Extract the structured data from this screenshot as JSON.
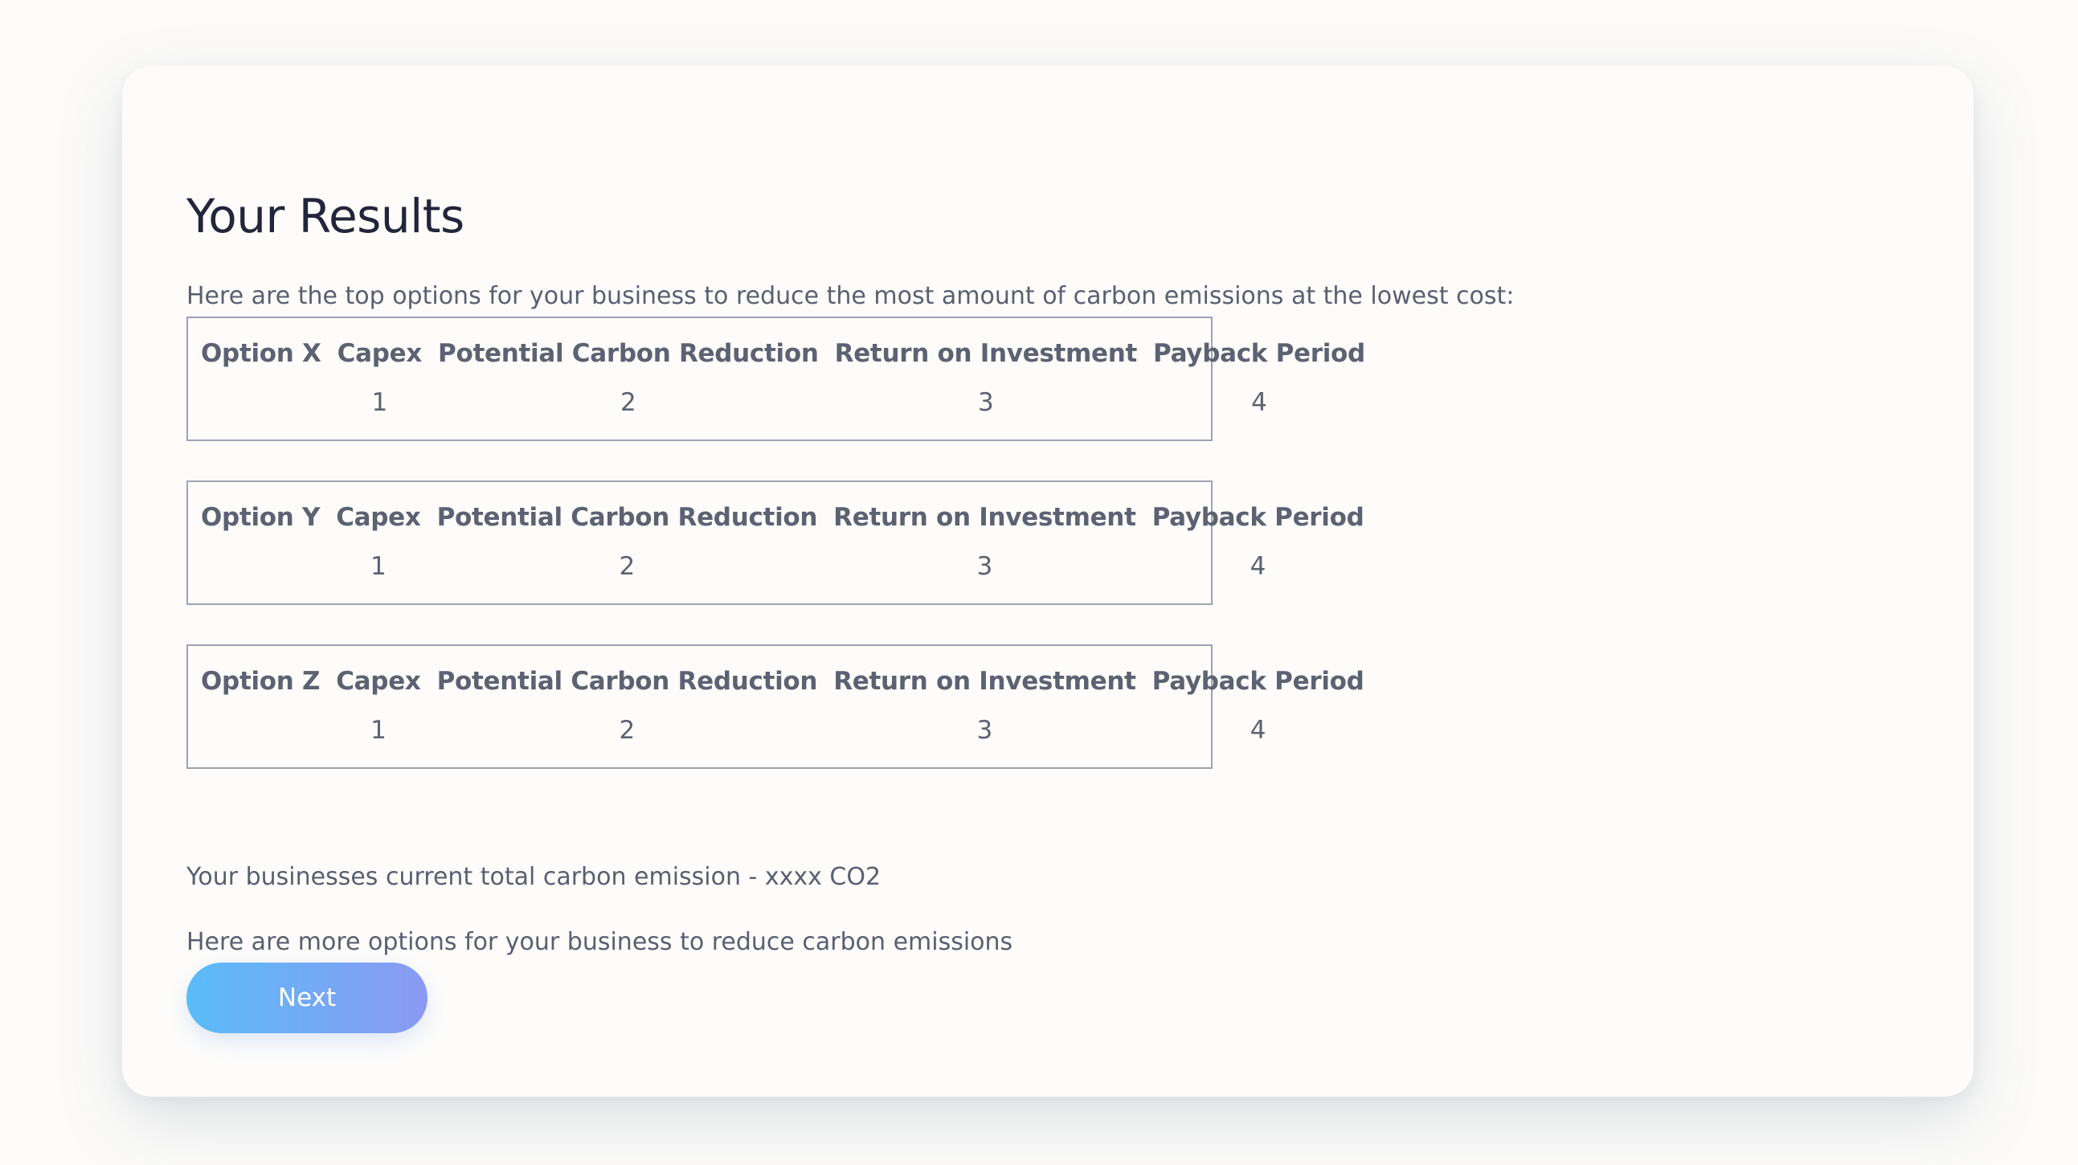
{
  "page": {
    "title": "Your Results",
    "intro": "Here are the top options for your business to reduce the most amount of carbon emissions at the lowest cost:",
    "emission_text": "Your businesses current total carbon emission - xxxx CO2",
    "more_text": "Here are more options for your business to reduce carbon emissions",
    "next_label": "Next"
  },
  "columns": {
    "capex": "Capex",
    "pcr": "Potential Carbon Reduction",
    "roi": "Return on Investment",
    "pp": "Payback Period"
  },
  "options": [
    {
      "name": "Option X",
      "capex": "1",
      "pcr": "2",
      "roi": "3",
      "pp": "4"
    },
    {
      "name": "Option Y",
      "capex": "1",
      "pcr": "2",
      "roi": "3",
      "pp": "4"
    },
    {
      "name": "Option Z",
      "capex": "1",
      "pcr": "2",
      "roi": "3",
      "pp": "4"
    }
  ],
  "colors": {
    "accent_start": "#5abcf8",
    "accent_end": "#8b99f2",
    "title": "#23253a",
    "text": "#5a5f70",
    "border": "#9ea3b2"
  }
}
